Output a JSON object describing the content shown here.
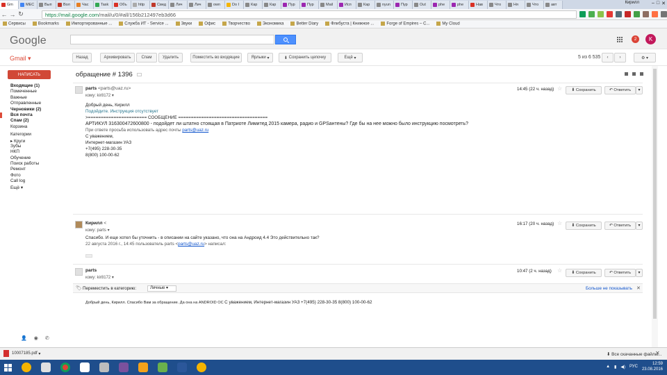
{
  "browser": {
    "tabs": [
      {
        "title": "Gm",
        "color": "#d93025"
      },
      {
        "title": "МЕС",
        "color": "#4285f4"
      },
      {
        "title": "Вып",
        "color": "#888"
      },
      {
        "title": "Вол",
        "color": "#c0392b"
      },
      {
        "title": "Час",
        "color": "#e67e22"
      },
      {
        "title": "Task",
        "color": "#34a853"
      },
      {
        "title": "Объ",
        "color": "#d93025"
      },
      {
        "title": "http",
        "color": "#aaa"
      },
      {
        "title": "Свед",
        "color": "#c0392b"
      },
      {
        "title": "Лич",
        "color": "#888"
      },
      {
        "title": "Лич",
        "color": "#888"
      },
      {
        "title": "own",
        "color": "#888"
      },
      {
        "title": "Do I",
        "color": "#f4b400"
      },
      {
        "title": "Кар",
        "color": "#888"
      },
      {
        "title": "Кар",
        "color": "#888"
      },
      {
        "title": "Пур",
        "color": "#9c27b0"
      },
      {
        "title": "Пур",
        "color": "#9c27b0"
      },
      {
        "title": "Mail",
        "color": "#888"
      },
      {
        "title": "Исп",
        "color": "#9c27b0"
      },
      {
        "title": "Кар",
        "color": "#888"
      },
      {
        "title": "nyun",
        "color": "#888"
      },
      {
        "title": "Пур",
        "color": "#9c27b0"
      },
      {
        "title": "Out",
        "color": "#888"
      },
      {
        "title": "phe",
        "color": "#9c27b0"
      },
      {
        "title": "phe",
        "color": "#9c27b0"
      },
      {
        "title": "Нав",
        "color": "#d93025"
      },
      {
        "title": "Что",
        "color": "#888"
      },
      {
        "title": "Ня",
        "color": "#888"
      },
      {
        "title": "Что",
        "color": "#888"
      },
      {
        "title": "авт",
        "color": "#888"
      }
    ],
    "user": "Кирилл",
    "url_host": "https://mail.google.com",
    "url_path": "/mail/u/0/#all/156b212497eb3d66",
    "bookmarks": [
      "Сервисы",
      "Bookmarks",
      "Импортированные ...",
      "Служба ИТ - Service ...",
      "Звуки",
      "Офис",
      "Творчество",
      "Экономика",
      "Better Diary",
      "Флибуста | Книжное ...",
      "Forge of Empires – С...",
      "My Cloud"
    ]
  },
  "google": {
    "logo": "Google",
    "notifications": "2",
    "avatar_letter": "K",
    "accent": "#dd4b39",
    "search_color": "#4d90fe"
  },
  "toolbar": {
    "gmail": "Gmail",
    "back": "Назад",
    "archive": "Архивировать",
    "spam": "Спам",
    "delete": "Удалить",
    "move_inbox": "Поместить во входящие",
    "labels": "Ярлыки",
    "save_chain": "Сохранить цепочку",
    "more": "Ещё",
    "count": "5 из 6 535"
  },
  "sidebar": {
    "compose": "НАПИСАТЬ",
    "items": [
      "Входящие (1)",
      "Помеченные",
      "Важные",
      "Отправленные",
      "Черновики (2)",
      "Вся почта",
      "Спам (2)",
      "Корзина",
      "Категории",
      "Круги",
      "Зубы",
      "НКП",
      "Обучение",
      "Поиск работы",
      "Ремонт",
      "Фото",
      "Call log",
      "Ещё"
    ]
  },
  "thread": {
    "subject": "обращение # 1396",
    "messages": [
      {
        "sender": "parts",
        "email": "<parts@uaz.ru>",
        "to": "кому: kir8172",
        "time": "14:45 (22 ч. назад)",
        "save": "Сохранить",
        "reply": "Ответить",
        "lines": [
          "Добрый день, Кирилл",
          "Подойдите. Инструкция отсутствует",
          "",
          "",
          "",
          "",
          ">======================= СООБЩЕНИЕ ===================================",
          "АРТИКУЛ 316300472600800 - подойдет ли штатно стоящая в Патриоте Лимитед 2015 камера, радио и GPSантены? Где бы на нее можно было инструкцию посмотреть?",
          "",
          "При ответе просьба использовать адрес почты",
          "",
          "С уважением,",
          "Интернет-магазин УАЗ",
          "+7(495) 228-30-35",
          "8(800) 100-00-62"
        ],
        "link": "parts@uaz.ru"
      },
      {
        "sender": "Кирилл",
        "email": "<",
        "to": "кому: parts",
        "time": "16:17 (20 ч. назад)",
        "save": "Сохранить",
        "reply": "Ответить",
        "lines": [
          "Спасибо. И еще хотел бы уточнить - в описании на сайте указано, что она на Андроид 4.4 Это действительно так?",
          "",
          "22 августа 2016 г., 14:45 пользователь parts",
          "написал:"
        ],
        "link": "parts@uaz.ru"
      },
      {
        "sender": "parts",
        "to": "кому: kir8172",
        "time": "10:47 (2 ч. назад)",
        "save": "Сохранить",
        "reply": "Ответить",
        "category_label": "Переместить в категорию:",
        "category_value": "Личные",
        "hide": "Больше не показывать",
        "lines": [
          "Добрый день, Кирилл.",
          "Спасибо Вам за обращение. Да она на ANDROID OC",
          "",
          "С уважением,",
          "Интернет-магазин УАЗ",
          "+7(495) 228-30-35",
          "8(800) 100-00-62"
        ]
      }
    ]
  },
  "downloads": {
    "file": "10007185.pdf",
    "all": "Все скачанные файлы..."
  },
  "taskbar": {
    "lang": "РУС",
    "time": "12:59",
    "date": "23.08.2016"
  }
}
